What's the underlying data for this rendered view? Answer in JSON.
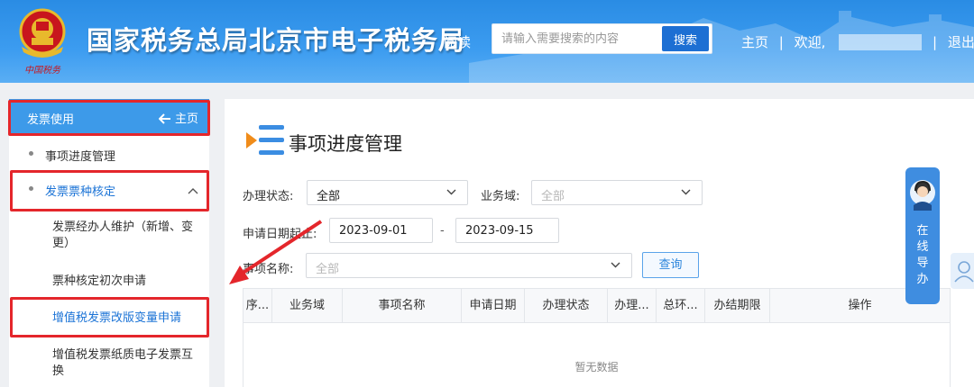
{
  "header": {
    "site_title": "国家税务总局北京市电子税务局",
    "emblem_caption": "中国税务",
    "read_link": "阅读",
    "search": {
      "placeholder": "请输入需要搜索的内容",
      "button": "搜索"
    },
    "nav": {
      "home": "主页",
      "separator": "|",
      "welcome": "欢迎,",
      "user_suffix": "|",
      "logout": "退出"
    }
  },
  "sidebar": {
    "header": {
      "title": "发票使用",
      "home": "主页"
    },
    "items": [
      {
        "label": "事项进度管理"
      },
      {
        "label": "发票票种核定",
        "expanded": true
      },
      {
        "label": "发票经办人维护（新增、变更）"
      },
      {
        "label": "票种核定初次申请"
      },
      {
        "label": "增值税发票改版变量申请",
        "active": true
      },
      {
        "label": "增值税发票纸质电子发票互换"
      }
    ]
  },
  "main": {
    "title": "事项进度管理",
    "filters": {
      "status_label": "办理状态:",
      "status_value": "全部",
      "domain_label": "业务域:",
      "domain_placeholder": "全部",
      "date_label": "申请日期起止:",
      "date_from": "2023-09-01",
      "date_dash": "-",
      "date_to": "2023-09-15",
      "item_label": "事项名称:",
      "item_placeholder": "全部",
      "query_button": "查询"
    },
    "table": {
      "columns": [
        "序...",
        "业务域",
        "事项名称",
        "申请日期",
        "办理状态",
        "办理...",
        "总环...",
        "办结期限",
        "操作"
      ],
      "empty_text": "暂无数据"
    }
  },
  "online_guide": {
    "chars": [
      "在",
      "线",
      "导",
      "办"
    ]
  },
  "colors": {
    "header_blue": "#2a8ce4",
    "sidebar_head": "#3d9ae9",
    "highlight_red": "#e4262b",
    "active_link": "#1b73d6"
  }
}
